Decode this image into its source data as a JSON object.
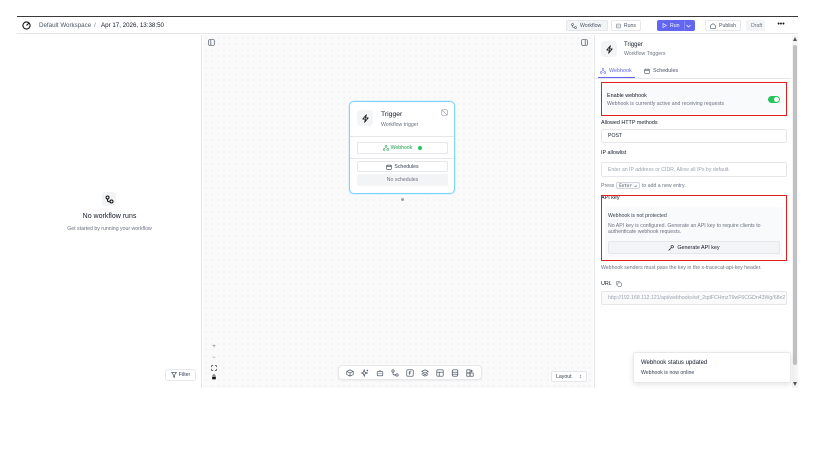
{
  "header": {
    "workspace": "Default Workspace",
    "separator": "/",
    "workflow_date": "Apr 17, 2026, 13:38:50",
    "workflow_tab": "Workflow",
    "runs_tab": "Runs",
    "run_label": "Run",
    "publish_label": "Publish",
    "draft_label": "Draft",
    "more_label": "•••"
  },
  "left_panel": {
    "empty_title": "No workflow runs",
    "empty_subtitle": "Get started by running your workflow",
    "filter_label": "Filter"
  },
  "canvas": {
    "node": {
      "title": "Trigger",
      "subtitle": "Workflow trigger",
      "webhook_label": "Webhook",
      "schedules_label": "Schedules",
      "no_schedules": "No schedules"
    },
    "zoom": {
      "in": "+",
      "out": "−"
    },
    "layout_label": "Layout",
    "layout_arrow": "↕"
  },
  "right_panel": {
    "title": "Trigger",
    "subtitle": "Workflow Triggers",
    "tabs": [
      {
        "label": "Webhook",
        "active": true
      },
      {
        "label": "Schedules",
        "active": false
      }
    ],
    "enable_webhook": {
      "label": "Enable webhook",
      "description": "Webhook is currently active and receiving requests",
      "enabled": true
    },
    "allowed_methods": {
      "label": "Allowed HTTP methods",
      "value": "POST"
    },
    "ip_allowlist": {
      "label": "IP allowlist",
      "placeholder": "Enter an IP address or CIDR. Allow all IPs by default.",
      "hint_prefix": "Press",
      "hint_key": "Enter ↵",
      "hint_suffix": "to add a new entry."
    },
    "api_key": {
      "label": "API key",
      "status": "Webhook is not protected",
      "description": "No API key is configured. Generate an API key to require clients to authenticate webhook requests.",
      "button": "Generate API key"
    },
    "senders_note": "Webhook senders must pass the key in the x-tracecat-api-key header.",
    "url": {
      "label": "URL",
      "value": "http://192.168.112.121/api/webhooks/wf_2qdFCHmzT9wF6CGDn43Wg/68e2"
    }
  },
  "toast": {
    "title": "Webhook status updated",
    "body": "Webhook is now online"
  },
  "colors": {
    "accent": "#6366f1",
    "success": "#22c55e",
    "highlight": "#e11d1d",
    "node_border": "#7dd3fc"
  }
}
